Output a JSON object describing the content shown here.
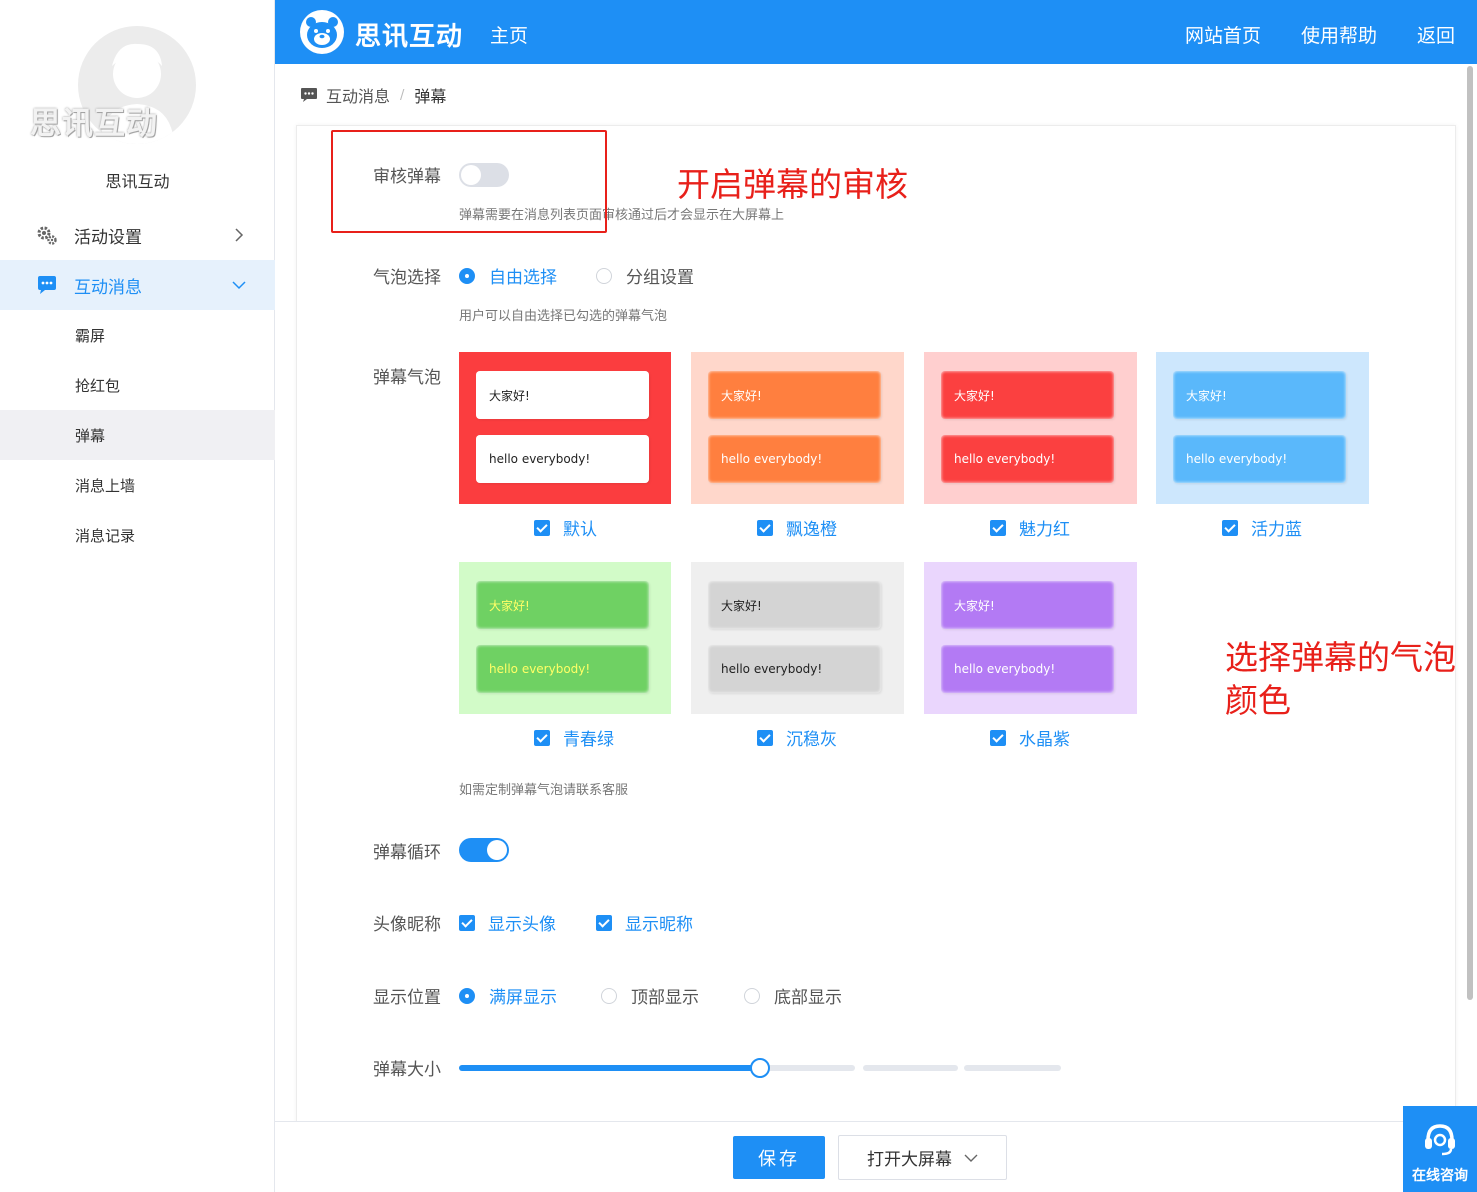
{
  "sidebar": {
    "avatar_watermark": "思讯互动",
    "org_name": "思讯互动",
    "menu": [
      {
        "label": "活动设置",
        "icon": "gears-icon"
      },
      {
        "label": "互动消息",
        "icon": "chat-bubble-icon"
      }
    ],
    "submenu": [
      "霸屏",
      "抢红包",
      "弹幕",
      "消息上墙",
      "消息记录"
    ]
  },
  "topbar": {
    "brand": "思讯互动",
    "home": "主页",
    "links": [
      "网站首页",
      "使用帮助",
      "返回"
    ]
  },
  "breadcrumb": {
    "parent": "互动消息",
    "sep": "/",
    "current": "弹幕"
  },
  "form": {
    "review": {
      "label": "审核弹幕",
      "enabled": false,
      "hint": "弹幕需要在消息列表页面审核通过后才会显示在大屏幕上"
    },
    "bubble_select": {
      "label": "气泡选择",
      "options": [
        "自由选择",
        "分组设置"
      ],
      "selected": "自由选择",
      "hint": "用户可以自由选择已勾选的弹幕气泡"
    },
    "bubbles": {
      "label": "弹幕气泡",
      "greeting": "大家好!",
      "greeting_en": "hello everybody!",
      "items": [
        {
          "name": "默认",
          "checked": true,
          "bg": "#fb3d3f",
          "bubble": "#ffffff",
          "text": "#222222"
        },
        {
          "name": "飘逸橙",
          "checked": true,
          "bg": "#ffd7cb",
          "bubble": "#ff7f3f",
          "text": "#ffffff"
        },
        {
          "name": "魅力红",
          "checked": true,
          "bg": "#ffcfcf",
          "bubble": "#fb4040",
          "text": "#ffffff"
        },
        {
          "name": "活力蓝",
          "checked": true,
          "bg": "#cde7fd",
          "bubble": "#5ab8fb",
          "text": "#ffffff"
        },
        {
          "name": "青春绿",
          "checked": true,
          "bg": "#d2fbc8",
          "bubble": "#6fd163",
          "text": "#ffff66"
        },
        {
          "name": "沉稳灰",
          "checked": true,
          "bg": "#efefef",
          "bubble": "#d4d4d4",
          "text": "#222222"
        },
        {
          "name": "水晶紫",
          "checked": true,
          "bg": "#ead6fd",
          "bubble": "#b37af4",
          "text": "#ffffff"
        }
      ],
      "hint": "如需定制弹幕气泡请联系客服"
    },
    "loop": {
      "label": "弹幕循环",
      "enabled": true
    },
    "avatar_nick": {
      "label": "头像昵称",
      "options": [
        "显示头像",
        "显示昵称"
      ]
    },
    "position": {
      "label": "显示位置",
      "options": [
        "满屏显示",
        "顶部显示",
        "底部显示"
      ],
      "selected": "满屏显示"
    },
    "size": {
      "label": "弹幕大小",
      "value_fraction": 0.5
    }
  },
  "annotations": {
    "review": "开启弹幕的审核",
    "bubble_line1": "选择弹幕的气泡",
    "bubble_line2": "颜色"
  },
  "footer": {
    "save": "保存",
    "open_screen": "打开大屏幕"
  },
  "consult": {
    "label": "在线咨询"
  },
  "colors": {
    "accent": "#1e8ff5",
    "annotation": "#e8201a"
  }
}
